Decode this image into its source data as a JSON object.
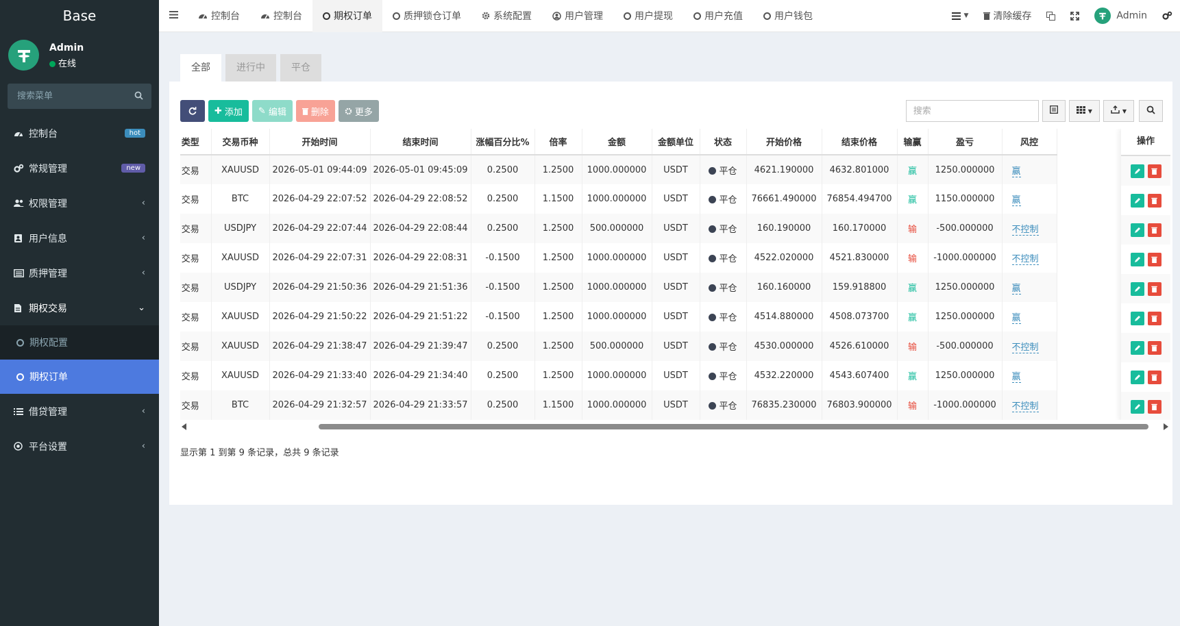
{
  "app": {
    "logo": "Base"
  },
  "user": {
    "name": "Admin",
    "status": "在线"
  },
  "sidebar": {
    "search_placeholder": "搜索菜单",
    "items": [
      {
        "label": "控制台",
        "badge": "hot",
        "icon": "dashboard-icon"
      },
      {
        "label": "常规管理",
        "badge": "new",
        "icon": "cogs-icon"
      },
      {
        "label": "权限管理",
        "icon": "users-icon"
      },
      {
        "label": "用户信息",
        "icon": "address-book-icon"
      },
      {
        "label": "质押管理",
        "icon": "list-alt-icon"
      },
      {
        "label": "期权交易",
        "icon": "file-text-icon"
      },
      {
        "label": "借贷管理",
        "icon": "list-icon"
      },
      {
        "label": "平台设置",
        "icon": "bullseye-icon"
      }
    ],
    "sub_items": [
      {
        "label": "期权配置",
        "active": false
      },
      {
        "label": "期权订单",
        "active": true
      }
    ]
  },
  "topnav": {
    "tabs": [
      {
        "label": "控制台",
        "icon": "dashboard-icon"
      },
      {
        "label": "控制台",
        "icon": "dashboard-icon"
      },
      {
        "label": "期权订单",
        "icon": "circle-o-icon",
        "active": true
      },
      {
        "label": "质押锁仓订单",
        "icon": "circle-o-icon"
      },
      {
        "label": "系统配置",
        "icon": "gear-icon"
      },
      {
        "label": "用户管理",
        "icon": "user-circle-icon"
      },
      {
        "label": "用户提现",
        "icon": "circle-o-icon"
      },
      {
        "label": "用户充值",
        "icon": "circle-o-icon"
      },
      {
        "label": "用户钱包",
        "icon": "circle-o-icon"
      }
    ],
    "clear_cache": "清除缓存",
    "admin_name": "Admin"
  },
  "page_tabs": [
    "全部",
    "进行中",
    "平仓"
  ],
  "toolbar": {
    "add": "添加",
    "edit": "编辑",
    "delete": "删除",
    "more": "更多",
    "search_placeholder": "搜索"
  },
  "table": {
    "headers": [
      "类型",
      "交易币种",
      "开始时间",
      "结束时间",
      "涨幅百分比%",
      "倍率",
      "金额",
      "金额单位",
      "状态",
      "开始价格",
      "结束价格",
      "输赢",
      "盈亏",
      "风控"
    ],
    "ops_header": "操作",
    "rows": [
      [
        "交易",
        "XAUUSD",
        "2026-05-01 09:44:09",
        "2026-05-01 09:45:09",
        "0.2500",
        "1.2500",
        "1000.000000",
        "USDT",
        "平仓",
        "4621.190000",
        "4632.801000",
        "赢",
        "1250.000000",
        "赢"
      ],
      [
        "交易",
        "BTC",
        "2026-04-29 22:07:52",
        "2026-04-29 22:08:52",
        "0.2500",
        "1.1500",
        "1000.000000",
        "USDT",
        "平仓",
        "76661.490000",
        "76854.494700",
        "赢",
        "1150.000000",
        "赢"
      ],
      [
        "交易",
        "USDJPY",
        "2026-04-29 22:07:44",
        "2026-04-29 22:08:44",
        "0.2500",
        "1.2500",
        "500.000000",
        "USDT",
        "平仓",
        "160.190000",
        "160.170000",
        "输",
        "-500.000000",
        "不控制"
      ],
      [
        "交易",
        "XAUUSD",
        "2026-04-29 22:07:31",
        "2026-04-29 22:08:31",
        "-0.1500",
        "1.2500",
        "1000.000000",
        "USDT",
        "平仓",
        "4522.020000",
        "4521.830000",
        "输",
        "-1000.000000",
        "不控制"
      ],
      [
        "交易",
        "USDJPY",
        "2026-04-29 21:50:36",
        "2026-04-29 21:51:36",
        "-0.1500",
        "1.2500",
        "1000.000000",
        "USDT",
        "平仓",
        "160.160000",
        "159.918800",
        "赢",
        "1250.000000",
        "赢"
      ],
      [
        "交易",
        "XAUUSD",
        "2026-04-29 21:50:22",
        "2026-04-29 21:51:22",
        "-0.1500",
        "1.2500",
        "1000.000000",
        "USDT",
        "平仓",
        "4514.880000",
        "4508.073700",
        "赢",
        "1250.000000",
        "赢"
      ],
      [
        "交易",
        "XAUUSD",
        "2026-04-29 21:38:47",
        "2026-04-29 21:39:47",
        "0.2500",
        "1.2500",
        "500.000000",
        "USDT",
        "平仓",
        "4530.000000",
        "4526.610000",
        "输",
        "-500.000000",
        "不控制"
      ],
      [
        "交易",
        "XAUUSD",
        "2026-04-29 21:33:40",
        "2026-04-29 21:34:40",
        "0.2500",
        "1.2500",
        "1000.000000",
        "USDT",
        "平仓",
        "4532.220000",
        "4543.607400",
        "赢",
        "1250.000000",
        "赢"
      ],
      [
        "交易",
        "BTC",
        "2026-04-29 21:32:57",
        "2026-04-29 21:33:57",
        "0.2500",
        "1.1500",
        "1000.000000",
        "USDT",
        "平仓",
        "76835.230000",
        "76803.900000",
        "输",
        "-1000.000000",
        "不控制"
      ]
    ]
  },
  "pager": {
    "summary": "显示第 1 到第 9 条记录，总共 9 条记录"
  },
  "colors": {
    "sidebar_bg": "#222d32",
    "active_blue": "#4d7adf",
    "win": "#18bc9c",
    "lose": "#e74c3c",
    "add_green": "#18bc9c"
  }
}
